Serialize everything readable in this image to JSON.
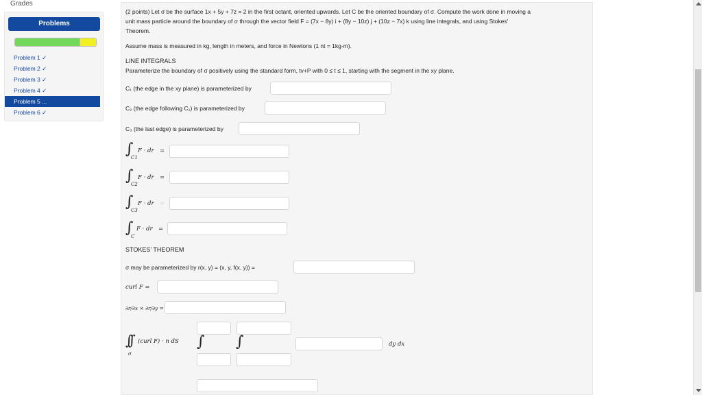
{
  "sidebar": {
    "grades_link": "Grades",
    "problems_button": "Problems",
    "progress": {
      "green_fraction": 0.8,
      "yellow_fraction": 0.2
    },
    "items": [
      {
        "label": "Problem 1 ✓"
      },
      {
        "label": "Problem 2 ✓"
      },
      {
        "label": "Problem 3 ✓"
      },
      {
        "label": "Problem 4 ✓"
      },
      {
        "label": "Problem 5 ..."
      },
      {
        "label": "Problem 6 ✓"
      }
    ]
  },
  "problem": {
    "statement_line1": "(2 points) Let σ be the surface 1x + 5y + 7z = 2 in the first octant, oriented upwards. Let C be the oriented boundary of σ. Compute the work done in moving a",
    "statement_line2": "unit mass particle around the boundary of σ through the vector field F = (7x − 8y) i + (8y − 10z) j + (10z − 7x) k using line integrals, and using Stokes'",
    "statement_line3": "Theorem.",
    "units_note": "Assume mass is measured in kg, length in meters, and force in Newtons (1 nt = 1kg-m).",
    "line_integrals_heading": "LINE INTEGRALS",
    "parameterize_instruction": "Parameterize the boundary of σ positively using the standard form, tv+P with 0 ≤ t ≤ 1, starting with the segment in the xy plane.",
    "c1_label": "C₁ (the edge in the xy plane) is parameterized by",
    "c2_label": "C₂ (the edge following C₁) is parameterized by",
    "c3_label": "C₃ (the last edge) is parameterized by",
    "integrand": "F · dr",
    "equals": "=",
    "int_c1_sub": "C1",
    "int_c2_sub": "C2",
    "int_c3_sub": "C3",
    "int_c_sub": "C",
    "stokes_heading": "STOKES' THEOREM",
    "sigma_param_label": "σ may be parameterized by r(x, y) = (x, y, f(x, y)) =",
    "curl_label": "curl F =",
    "cross_label": "∂r/∂x × ∂r/∂y =",
    "surface_integral_label": "(curl F) · n dS",
    "surface_sub": "σ",
    "dydx_label": "dy dx"
  }
}
